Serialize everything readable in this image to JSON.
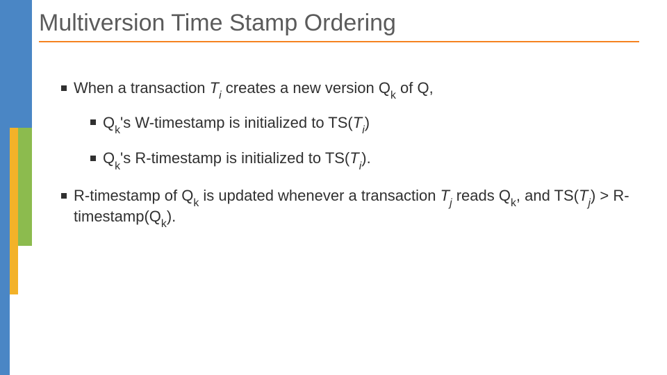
{
  "title": "Multiversion Time Stamp Ordering",
  "bullets": {
    "b1": {
      "pre": "When a transaction ",
      "t": "T",
      "ts": "i",
      "mid1": " creates a new version Q",
      "qs": "k",
      "post": " of Q,"
    },
    "b1a": {
      "pre": "Q",
      "qs": "k",
      "mid": "'s W-timestamp is initialized to TS(",
      "t": "T",
      "ts": "i",
      "post": ")"
    },
    "b1b": {
      "pre": "Q",
      "qs": "k",
      "mid": "'s R-timestamp is initialized to TS(",
      "t": "T",
      "ts": "i",
      "post": ")."
    },
    "b2": {
      "pre": "R-timestamp of Q",
      "qs1": "k",
      "mid1": " is updated whenever a transaction ",
      "t1": "T",
      "ts1": "j",
      "mid2": " reads Q",
      "qs2": "k",
      "mid3": ", and TS(",
      "t2": "T",
      "ts2": "j",
      "mid4": ") > R-timestamp(Q",
      "qs3": "k",
      "post": ")."
    }
  }
}
